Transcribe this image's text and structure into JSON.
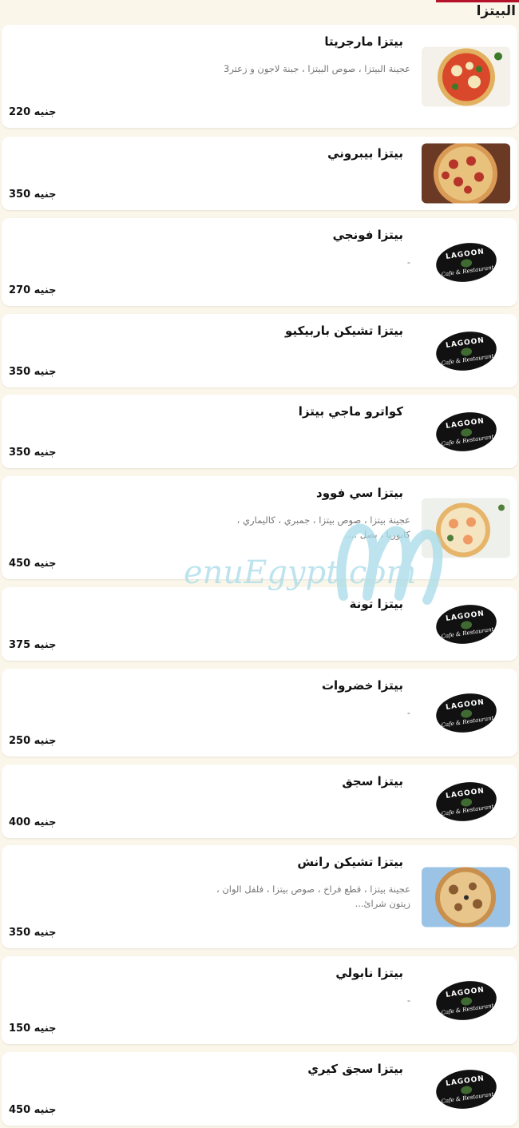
{
  "section": {
    "title": "البيتزا"
  },
  "currency": "جنيه",
  "items": [
    {
      "name": "بيتزا مارجريتا",
      "desc": "عجينة البيتزا ، صوص البيتزا ، جبنة لاجون و زعتر3",
      "price": "220 جنيه",
      "image": "margherita-photo"
    },
    {
      "name": "بيتزا بيبروني",
      "desc": "",
      "price": "350 جنيه",
      "image": "pepperoni-photo"
    },
    {
      "name": "بيتزا فونجي",
      "desc": "-",
      "price": "270 جنيه",
      "image": "lagoon-logo"
    },
    {
      "name": "بيتزا تشيكن باربيكيو",
      "desc": "",
      "price": "350 جنيه",
      "image": "lagoon-logo"
    },
    {
      "name": "كواترو ماجي بيتزا",
      "desc": "",
      "price": "350 جنيه",
      "image": "lagoon-logo"
    },
    {
      "name": "بيتزا سي فوود",
      "desc": "عجينة بيتزا ، صوص بيتزا ، جمبري ، كاليماري ، كابوريا ، بصل ....",
      "price": "450 جنيه",
      "image": "seafood-photo"
    },
    {
      "name": "بيتزا تونة",
      "desc": "",
      "price": "375 جنيه",
      "image": "lagoon-logo"
    },
    {
      "name": "بيتزا خضروات",
      "desc": "-",
      "price": "250 جنيه",
      "image": "lagoon-logo"
    },
    {
      "name": "بيتزا سجق",
      "desc": "",
      "price": "400 جنيه",
      "image": "lagoon-logo"
    },
    {
      "name": "بيتزا تشيكن رانش",
      "desc": "عجينة بيتزا ، قطع فراخ ، صوص بيتزا ، فلفل الوان ، زيتون شرائ...",
      "price": "350 جنيه",
      "image": "chicken-ranch-photo"
    },
    {
      "name": "بيتزا نابولي",
      "desc": "-",
      "price": "150 جنيه",
      "image": "lagoon-logo"
    },
    {
      "name": "بيتزا سجق كيري",
      "desc": "",
      "price": "450 جنيه",
      "image": "lagoon-logo"
    }
  ],
  "logo": {
    "top": "LAGOON",
    "bottom": "Cafe & Restaurant"
  },
  "watermark": "enuEgypt.com",
  "colors": {
    "accent": "#b3122a",
    "background": "#fbf6ea",
    "card": "#ffffff",
    "watermark": "#a8dce9"
  }
}
